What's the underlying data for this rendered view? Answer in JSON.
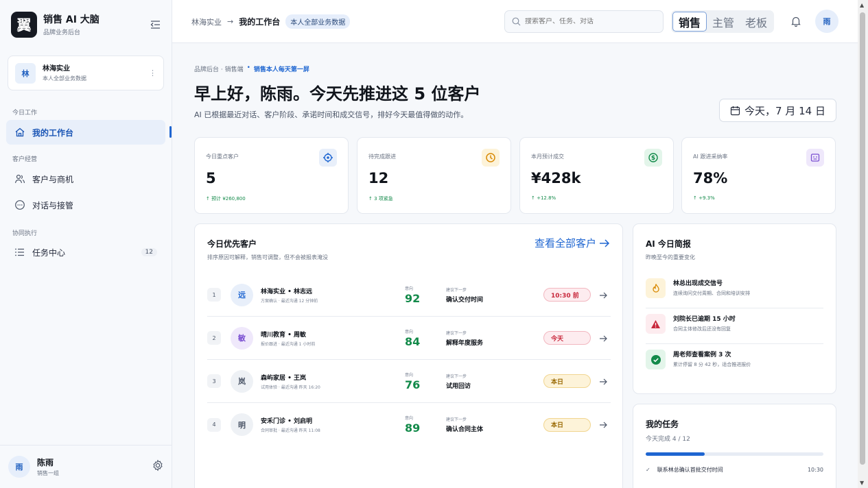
{
  "brand": {
    "logo_char": "翼",
    "title": "销售 AI 大脑",
    "subtitle": "品牌业务后台"
  },
  "org": {
    "avatar": "林",
    "name": "林海实业",
    "sub": "本人全部业务数据"
  },
  "nav": {
    "section_today": "今日工作",
    "workspace": "我的工作台",
    "section_customer": "客户经营",
    "customers": "客户与商机",
    "conversations": "对话与接管",
    "section_collab": "协同执行",
    "tasks": "任务中心",
    "tasks_badge": "12"
  },
  "user": {
    "avatar": "雨",
    "name": "陈雨",
    "team": "销售一组"
  },
  "topbar": {
    "crumb_org": "林海实业",
    "crumb_sep": "→",
    "crumb_current": "我的工作台",
    "crumb_pill": "本人全部业务数据",
    "search_placeholder": "搜索客户、任务、对话",
    "roles": [
      "销售",
      "主管",
      "老板"
    ],
    "avatar": "雨"
  },
  "header": {
    "eyebrow": "品牌后台 · 销售端",
    "eyebrow_dot": "•",
    "eyebrow_highlight": "销售本人每天第一屏",
    "greeting": "早上好，陈雨。今天先推进这 5 位客户",
    "subtitle": "AI 已根据最近对话、客户阶段、承诺时间和成交信号，排好今天最值得做的动作。",
    "date": "今天，7 月 14 日"
  },
  "stats": [
    {
      "label": "今日重点客户",
      "value": "5",
      "delta": "↑ 预计 ¥260,800",
      "icon": "target-icon",
      "color": "#1f66d1",
      "bg": "#e8effa"
    },
    {
      "label": "待完成跟进",
      "value": "12",
      "delta": "↑ 3 项紧急",
      "icon": "clock-icon",
      "color": "#d98a06",
      "bg": "#fdf3d9"
    },
    {
      "label": "本月预计成交",
      "value": "¥428k",
      "delta": "↑ +12.8%",
      "icon": "dollar-icon",
      "color": "#138a4a",
      "bg": "#e3f5ea"
    },
    {
      "label": "AI 跟进采纳率",
      "value": "78%",
      "delta": "↑ +9.3%",
      "icon": "robot-icon",
      "color": "#7a4fd1",
      "bg": "#efe8fb"
    }
  ],
  "priority": {
    "title": "今日优先客户",
    "subtitle": "排序原因可解释，销售可调整，但不会被报表淹没",
    "see_all": "查看全部客户",
    "intent_label": "意向",
    "next_label": "建议下一步",
    "rows": [
      {
        "rank": "1",
        "avatar": "远",
        "name": "林海实业 • 林志远",
        "meta": "方案确认 · 最近沟通 12 分钟前",
        "intent": "92",
        "next": "确认交付时间",
        "due": "10:30 前",
        "due_style": "red",
        "av_color": "#1f66d1",
        "av_bg": "#e8effa"
      },
      {
        "rank": "2",
        "avatar": "敏",
        "name": "晴川教育 • 周敏",
        "meta": "报价跟进 · 最近沟通 1 小时前",
        "intent": "84",
        "next": "解释年度服务",
        "due": "今天",
        "due_style": "red",
        "av_color": "#7a4fd1",
        "av_bg": "#efe8fb"
      },
      {
        "rank": "3",
        "avatar": "岚",
        "name": "森屿家居 • 王岚",
        "meta": "试用体验 · 最近沟通 昨天 16:20",
        "intent": "76",
        "next": "试用回访",
        "due": "本日",
        "due_style": "amber",
        "av_color": "#4b5567",
        "av_bg": "#eef1f5"
      },
      {
        "rank": "4",
        "avatar": "明",
        "name": "安禾门诊 • 刘启明",
        "meta": "合同审批 · 最近沟通 昨天 11:08",
        "intent": "89",
        "next": "确认合同主体",
        "due": "本日",
        "due_style": "amber",
        "av_color": "#4b5567",
        "av_bg": "#eef1f5"
      }
    ]
  },
  "brief": {
    "title": "AI 今日简报",
    "subtitle": "昨晚至今的重要变化",
    "items": [
      {
        "icon": "flame-icon",
        "title": "林总出现成交信号",
        "desc": "连续询问交付周期、合同和培训安排",
        "color": "#d98a06",
        "bg": "#fdf3d9"
      },
      {
        "icon": "alert-icon",
        "title": "刘院长已逾期 15 小时",
        "desc": "合同主体修改后还没有回复",
        "color": "#c8283c",
        "bg": "#fdecef"
      },
      {
        "icon": "check-circle-icon",
        "title": "周老师查看案例 3 次",
        "desc": "累计停留 8 分 42 秒，适合推进报价",
        "color": "#138a4a",
        "bg": "#e3f5ea"
      }
    ]
  },
  "tasks_card": {
    "title": "我的任务",
    "subtitle": "今天完成 4 / 12",
    "progress": 0.333,
    "first_task": "联系林总确认首批交付时间",
    "first_task_time": "10:30",
    "check": "✓"
  }
}
